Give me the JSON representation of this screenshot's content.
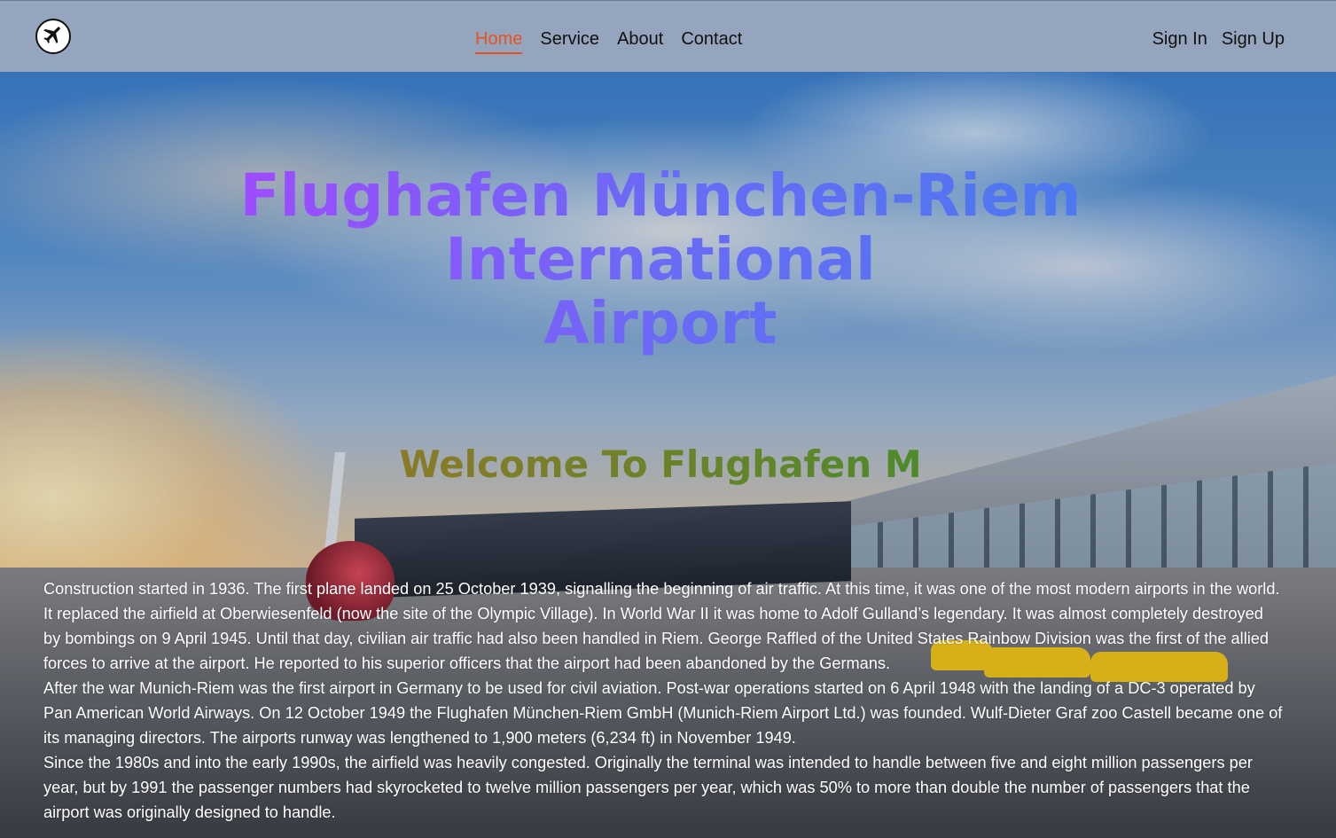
{
  "nav": {
    "logo_icon": "airplane-icon",
    "links": [
      "Home",
      "Service",
      "About",
      "Contact"
    ],
    "active_link": "Home",
    "active_color": "#e5541d",
    "sign_in": "Sign In",
    "sign_up": "Sign Up"
  },
  "hero": {
    "title_line1": "Flughafen München-Riem",
    "title_line2": "International",
    "title_line3": "Airport",
    "welcome": "Welcome To Flughafen M"
  },
  "content": {
    "paragraphs": [
      "Construction started in 1936. The first plane landed on 25 October 1939, signalling the beginning of air traffic. At this time, it was one of the most modern airports in the world. It replaced the airfield at Oberwiesenfeld (now the site of the Olympic Village). In World War II it was home to Adolf Gulland’s legendary. It was almost completely destroyed by bombings on 9 April 1945. Until that day, civilian air traffic had also been handled in Riem. George Raffled of the United States Rainbow Division was the first of the allied forces to arrive at the airport. He reported to his superior officers that the airport had been abandoned by the Germans.",
      "After the war Munich-Riem was the first airport in Germany to be used for civil aviation. Post-war operations started on 6 April 1948 with the landing of a DC-3 operated by Pan American World Airways. On 12 October 1949 the Flughafen München-Riem GmbH (Munich-Riem Airport Ltd.) was founded. Wulf-Dieter Graf zoo Castell became one of its managing directors. The airports runway was lengthened to 1,900 meters (6,234 ft) in November 1949.",
      "Since the 1980s and into the early 1990s, the airfield was heavily congested. Originally the terminal was intended to handle between five and eight million passengers per year, but by 1991 the passenger numbers had skyrocketed to twelve million passengers per year, which was 50% to more than double the number of passengers that the airport was originally designed to handle."
    ]
  }
}
